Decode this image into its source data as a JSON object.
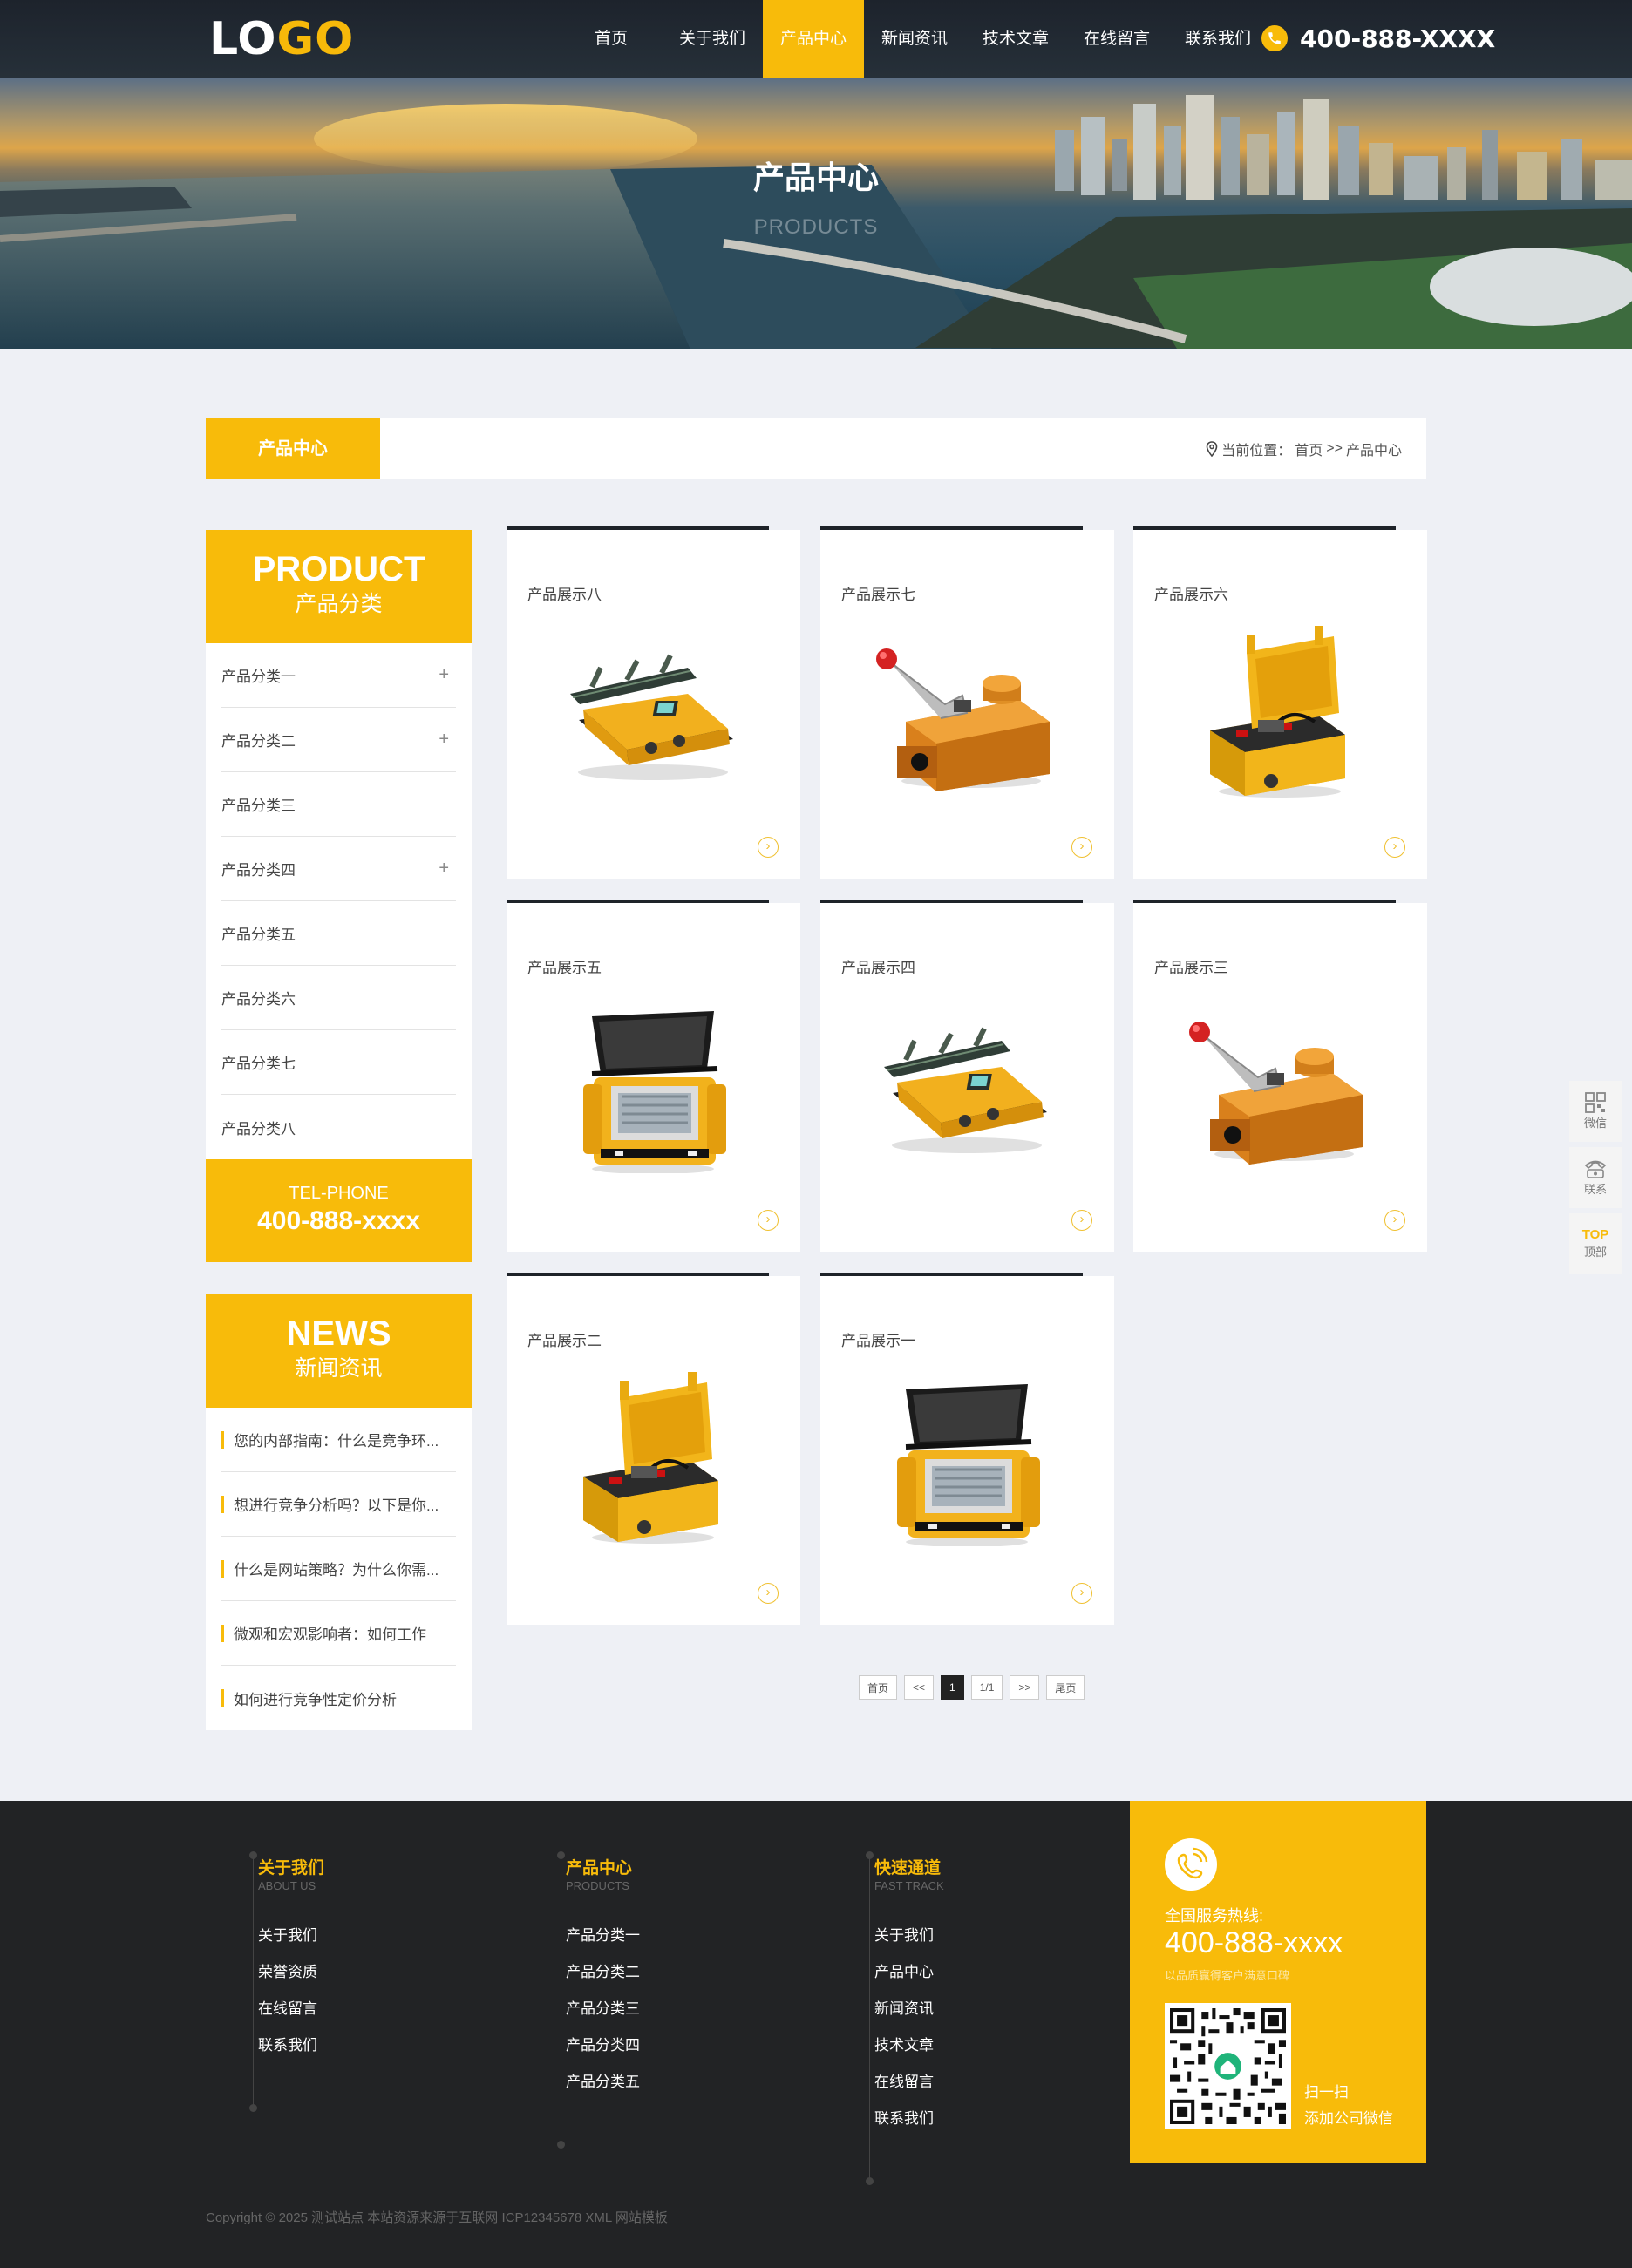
{
  "header": {
    "logo_part1": "LO",
    "logo_part2": "GO",
    "nav": [
      "首页",
      "关于我们",
      "产品中心",
      "新闻资讯",
      "技术文章",
      "在线留言",
      "联系我们"
    ],
    "active_nav": 2,
    "phone": "400-888-XXXX"
  },
  "banner": {
    "title": "产品中心",
    "subtitle": "PRODUCTS"
  },
  "crumb": {
    "tab": "产品中心",
    "prefix": "当前位置：",
    "home": "首页",
    "sep": ">>",
    "current": "产品中心"
  },
  "sidebar": {
    "product_en": "PRODUCT",
    "product_cn": "产品分类",
    "categories": [
      {
        "label": "产品分类一",
        "expandable": "+"
      },
      {
        "label": "产品分类二",
        "expandable": "+"
      },
      {
        "label": "产品分类三",
        "expandable": ""
      },
      {
        "label": "产品分类四",
        "expandable": "+"
      },
      {
        "label": "产品分类五",
        "expandable": ""
      },
      {
        "label": "产品分类六",
        "expandable": ""
      },
      {
        "label": "产品分类七",
        "expandable": ""
      },
      {
        "label": "产品分类八",
        "expandable": ""
      }
    ],
    "tel_label": "TEL-PHONE",
    "tel_number": "400-888-xxxx",
    "news_en": "NEWS",
    "news_cn": "新闻资讯",
    "news": [
      "您的内部指南：什么是竞争环...",
      "想进行竞争分析吗？以下是你...",
      "什么是网站策略？为什么你需...",
      "微观和宏观影响者：如何工作",
      "如何进行竞争性定价分析"
    ]
  },
  "products": [
    {
      "title": "产品展示八",
      "kind": "robot"
    },
    {
      "title": "产品展示七",
      "kind": "lever"
    },
    {
      "title": "产品展示六",
      "kind": "case"
    },
    {
      "title": "产品展示五",
      "kind": "machine"
    },
    {
      "title": "产品展示四",
      "kind": "robot"
    },
    {
      "title": "产品展示三",
      "kind": "lever"
    },
    {
      "title": "产品展示二",
      "kind": "case"
    },
    {
      "title": "产品展示一",
      "kind": "machine"
    }
  ],
  "pager": {
    "first": "首页",
    "prev": "<<",
    "current": "1",
    "total": "1/1",
    "next": ">>",
    "last": "尾页"
  },
  "float_bar": {
    "wechat": "微信",
    "contact": "联系",
    "top_icon": "TOP",
    "top": "顶部"
  },
  "footer": {
    "cols": [
      {
        "title": "关于我们",
        "sub": "ABOUT US",
        "links": [
          "关于我们",
          "荣誉资质",
          "在线留言",
          "联系我们"
        ]
      },
      {
        "title": "产品中心",
        "sub": "PRODUCTS",
        "links": [
          "产品分类一",
          "产品分类二",
          "产品分类三",
          "产品分类四",
          "产品分类五"
        ]
      },
      {
        "title": "快速通道",
        "sub": "FAST TRACK",
        "links": [
          "关于我们",
          "产品中心",
          "新闻资讯",
          "技术文章",
          "在线留言",
          "联系我们"
        ]
      }
    ],
    "hotline_label": "全国服务热线:",
    "hotline": "400-888-xxxx",
    "hotline_note": "以品质赢得客户满意口碑",
    "qr_line1": "扫一扫",
    "qr_line2": "添加公司微信",
    "copyright": "Copyright © 2025 测试站点 本站资源来源于互联网 ICP12345678 XML 网站模板"
  },
  "colors": {
    "accent": "#f8bb0a",
    "dark": "#222325",
    "header": "#1d232c",
    "page_bg": "#eef0f5"
  }
}
